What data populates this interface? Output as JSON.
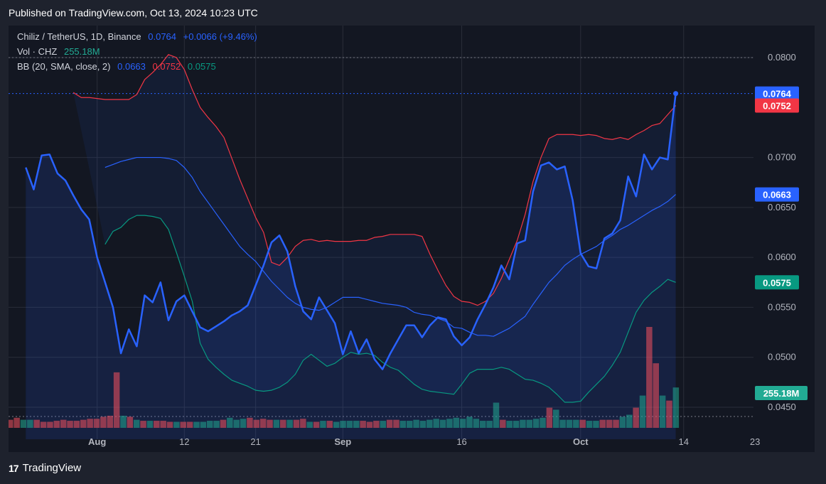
{
  "header": {
    "published": "Published on TradingView.com, Oct 13, 2024 10:23 UTC"
  },
  "legend": {
    "line1": {
      "symbol": "Chiliz / TetherUS, 1D, Binance",
      "price": "0.0764",
      "change": "+0.0066 (+9.46%)"
    },
    "line2": {
      "label": "Vol · CHZ",
      "value": "255.18M"
    },
    "line3": {
      "label": "BB (20, SMA, close, 2)",
      "basis": "0.0663",
      "upper": "0.0752",
      "lower": "0.0575"
    }
  },
  "footer": {
    "logo": "17",
    "brand": "TradingView"
  },
  "colors": {
    "price": "#2962ff",
    "upper": "#f23645",
    "lower": "#089981",
    "basis": "#2962ff",
    "text": "#d1d4dc",
    "bg": "#131722"
  },
  "chart_data": {
    "type": "line",
    "title": "",
    "x_tick_labels": [
      "Aug",
      "12",
      "21",
      "Sep",
      "16",
      "Oct",
      "14",
      "23"
    ],
    "y_tick_labels": [
      "0.0800",
      "0.0700",
      "0.0650",
      "0.0600",
      "0.0550",
      "0.0500",
      "0.0450"
    ],
    "ylim": [
      0.0418,
      0.0832
    ],
    "price_badges": [
      {
        "label": "0.0764",
        "value": 0.0764,
        "color": "#2962ff"
      },
      {
        "label": "0.0752",
        "value": 0.0752,
        "color": "#f23645"
      },
      {
        "label": "0.0663",
        "value": 0.0663,
        "color": "#2962ff"
      },
      {
        "label": "0.0575",
        "value": 0.0575,
        "color": "#089981"
      }
    ],
    "volume_badge": "255.18M",
    "x": [
      "Jul 21",
      "Jul 22",
      "Jul 23",
      "Jul 24",
      "Jul 25",
      "Jul 26",
      "Jul 27",
      "Jul 28",
      "Jul 29",
      "Jul 30",
      "Jul 31",
      "Aug 1",
      "Aug 2",
      "Aug 3",
      "Aug 4",
      "Aug 5",
      "Aug 6",
      "Aug 7",
      "Aug 8",
      "Aug 9",
      "Aug 10",
      "Aug 11",
      "Aug 12",
      "Aug 13",
      "Aug 14",
      "Aug 15",
      "Aug 16",
      "Aug 17",
      "Aug 18",
      "Aug 19",
      "Aug 20",
      "Aug 21",
      "Aug 22",
      "Aug 23",
      "Aug 24",
      "Aug 25",
      "Aug 26",
      "Aug 27",
      "Aug 28",
      "Aug 29",
      "Aug 30",
      "Aug 31",
      "Sep 1",
      "Sep 2",
      "Sep 3",
      "Sep 4",
      "Sep 5",
      "Sep 6",
      "Sep 7",
      "Sep 8",
      "Sep 9",
      "Sep 10",
      "Sep 11",
      "Sep 12",
      "Sep 13",
      "Sep 14",
      "Sep 15",
      "Sep 16",
      "Sep 17",
      "Sep 18",
      "Sep 19",
      "Sep 20",
      "Sep 21",
      "Sep 22",
      "Sep 23",
      "Sep 24",
      "Sep 25",
      "Sep 26",
      "Sep 27",
      "Sep 28",
      "Sep 29",
      "Sep 30",
      "Oct 1",
      "Oct 2",
      "Oct 3",
      "Oct 4",
      "Oct 5",
      "Oct 6",
      "Oct 7",
      "Oct 8",
      "Oct 9",
      "Oct 10",
      "Oct 11",
      "Oct 12",
      "Oct 13"
    ],
    "series": [
      {
        "name": "Chiliz / TetherUS",
        "color": "#2962ff",
        "values": [
          0.069,
          0.0668,
          0.0702,
          0.0703,
          0.0684,
          0.0677,
          0.0662,
          0.0648,
          0.0638,
          0.06,
          0.0575,
          0.055,
          0.0504,
          0.0528,
          0.0511,
          0.0562,
          0.0555,
          0.0575,
          0.0537,
          0.0556,
          0.0562,
          0.0546,
          0.053,
          0.0526,
          0.0531,
          0.0536,
          0.0542,
          0.0546,
          0.0552,
          0.0572,
          0.0592,
          0.0615,
          0.0622,
          0.0606,
          0.0571,
          0.0546,
          0.0538,
          0.056,
          0.0547,
          0.0534,
          0.0503,
          0.0526,
          0.0504,
          0.0518,
          0.0498,
          0.0488,
          0.0504,
          0.0518,
          0.0532,
          0.0532,
          0.052,
          0.0532,
          0.054,
          0.0538,
          0.0521,
          0.0512,
          0.052,
          0.0538,
          0.0553,
          0.057,
          0.0592,
          0.0578,
          0.0614,
          0.0617,
          0.0666,
          0.0692,
          0.0695,
          0.0688,
          0.0691,
          0.0657,
          0.0604,
          0.0591,
          0.0589,
          0.0619,
          0.0624,
          0.0637,
          0.0681,
          0.0661,
          0.0703,
          0.0688,
          0.07,
          0.0698,
          0.0764
        ]
      },
      {
        "name": "Upper",
        "color": "#f23645",
        "values": [
          0.0765,
          0.076,
          0.076,
          0.0759,
          0.0758,
          0.0758,
          0.0758,
          0.0758,
          0.0763,
          0.0778,
          0.0785,
          0.0793,
          0.0803,
          0.08,
          0.0788,
          0.0768,
          0.075,
          0.074,
          0.0731,
          0.072,
          0.0699,
          0.0678,
          0.0659,
          0.064,
          0.0625,
          0.0595,
          0.0592,
          0.06,
          0.0611,
          0.0617,
          0.0618,
          0.0616,
          0.0617,
          0.0616,
          0.0616,
          0.0616,
          0.0617,
          0.0617,
          0.062,
          0.0621,
          0.0623,
          0.0623,
          0.0623,
          0.0623,
          0.0621,
          0.0603,
          0.0587,
          0.0572,
          0.0561,
          0.0556,
          0.0555,
          0.0552,
          0.0556,
          0.0564,
          0.0579,
          0.0598,
          0.0617,
          0.0643,
          0.0676,
          0.07,
          0.0719,
          0.0723,
          0.0723,
          0.0723,
          0.0722,
          0.0723,
          0.0722,
          0.0719,
          0.0718,
          0.072,
          0.0718,
          0.0723,
          0.0727,
          0.0732,
          0.0734,
          0.0743,
          0.0752
        ]
      },
      {
        "name": "Basis",
        "color": "#2962ff",
        "values": [
          0.069,
          0.0693,
          0.0696,
          0.0698,
          0.07,
          0.07,
          0.07,
          0.07,
          0.0699,
          0.0697,
          0.069,
          0.068,
          0.0666,
          0.0655,
          0.0644,
          0.0633,
          0.0622,
          0.0611,
          0.0603,
          0.0596,
          0.0586,
          0.0576,
          0.0568,
          0.056,
          0.0554,
          0.055,
          0.0548,
          0.0547,
          0.055,
          0.0555,
          0.056,
          0.056,
          0.056,
          0.0558,
          0.0556,
          0.0554,
          0.0553,
          0.0552,
          0.055,
          0.0545,
          0.0543,
          0.0542,
          0.0539,
          0.0536,
          0.053,
          0.0529,
          0.0525,
          0.0522,
          0.0522,
          0.0521,
          0.0525,
          0.0529,
          0.0535,
          0.0541,
          0.0553,
          0.0564,
          0.0575,
          0.0583,
          0.0592,
          0.0598,
          0.0603,
          0.0607,
          0.0611,
          0.0617,
          0.0622,
          0.0628,
          0.0632,
          0.0637,
          0.0642,
          0.0647,
          0.0651,
          0.0656,
          0.0663
        ]
      },
      {
        "name": "Lower",
        "color": "#089981",
        "values": [
          0.0613,
          0.0626,
          0.063,
          0.0638,
          0.0642,
          0.0642,
          0.0641,
          0.0639,
          0.0628,
          0.0605,
          0.0581,
          0.0556,
          0.0514,
          0.0498,
          0.049,
          0.0483,
          0.0477,
          0.0474,
          0.0471,
          0.0467,
          0.0466,
          0.0467,
          0.047,
          0.0475,
          0.0483,
          0.0497,
          0.0503,
          0.0497,
          0.0491,
          0.0494,
          0.05,
          0.0505,
          0.0503,
          0.0504,
          0.0502,
          0.0495,
          0.049,
          0.0487,
          0.048,
          0.0473,
          0.0468,
          0.0466,
          0.0465,
          0.0464,
          0.0463,
          0.0473,
          0.0484,
          0.0488,
          0.0488,
          0.0488,
          0.049,
          0.0488,
          0.0483,
          0.0478,
          0.0477,
          0.0474,
          0.047,
          0.0463,
          0.0455,
          0.0455,
          0.0456,
          0.0465,
          0.0473,
          0.0481,
          0.0492,
          0.0505,
          0.0525,
          0.0545,
          0.0557,
          0.0565,
          0.0571,
          0.0578,
          0.0575
        ]
      }
    ],
    "volume": {
      "label": "Vol · CHZ",
      "values": [
        8,
        10,
        8,
        8,
        8,
        6,
        6,
        7,
        8,
        7,
        7,
        8,
        9,
        9,
        11,
        12,
        55,
        12,
        11,
        8,
        7,
        7,
        7,
        7,
        6,
        6,
        6,
        6,
        6,
        6,
        7,
        7,
        8,
        10,
        8,
        9,
        10,
        8,
        9,
        8,
        8,
        8,
        8,
        8,
        9,
        6,
        6,
        7,
        7,
        6,
        7,
        7,
        7,
        7,
        6,
        7,
        7,
        8,
        8,
        7,
        7,
        8,
        7,
        8,
        9,
        8,
        9,
        10,
        9,
        11,
        9,
        7,
        7,
        25,
        8,
        7,
        7,
        8,
        8,
        9,
        10,
        20,
        18,
        8,
        8,
        8,
        8,
        7,
        7,
        8,
        8,
        8,
        11,
        13,
        20,
        32,
        100,
        64,
        32,
        27,
        40
      ],
      "colors": [
        "r",
        "r",
        "g",
        "g",
        "r",
        "r",
        "r",
        "r",
        "r",
        "r",
        "r",
        "r",
        "r",
        "r",
        "r",
        "r",
        "r",
        "g",
        "r",
        "g",
        "r",
        "g",
        "r",
        "r",
        "r",
        "g",
        "r",
        "r",
        "g",
        "g",
        "g",
        "g",
        "r",
        "g",
        "g",
        "g",
        "r",
        "r",
        "r",
        "r",
        "g",
        "r",
        "g",
        "r",
        "r",
        "g",
        "r",
        "g",
        "r",
        "g",
        "g",
        "g",
        "g",
        "r",
        "r",
        "r",
        "g",
        "r",
        "r",
        "g",
        "g",
        "g",
        "g",
        "g",
        "g",
        "g",
        "g",
        "g",
        "g",
        "g",
        "g",
        "g",
        "g",
        "g",
        "r",
        "g",
        "g",
        "g",
        "g",
        "g",
        "g",
        "r",
        "g",
        "g",
        "g",
        "g",
        "r",
        "g",
        "g",
        "r",
        "r",
        "r",
        "g",
        "g",
        "r",
        "g",
        "r",
        "r",
        "g",
        "r",
        "g"
      ]
    }
  }
}
